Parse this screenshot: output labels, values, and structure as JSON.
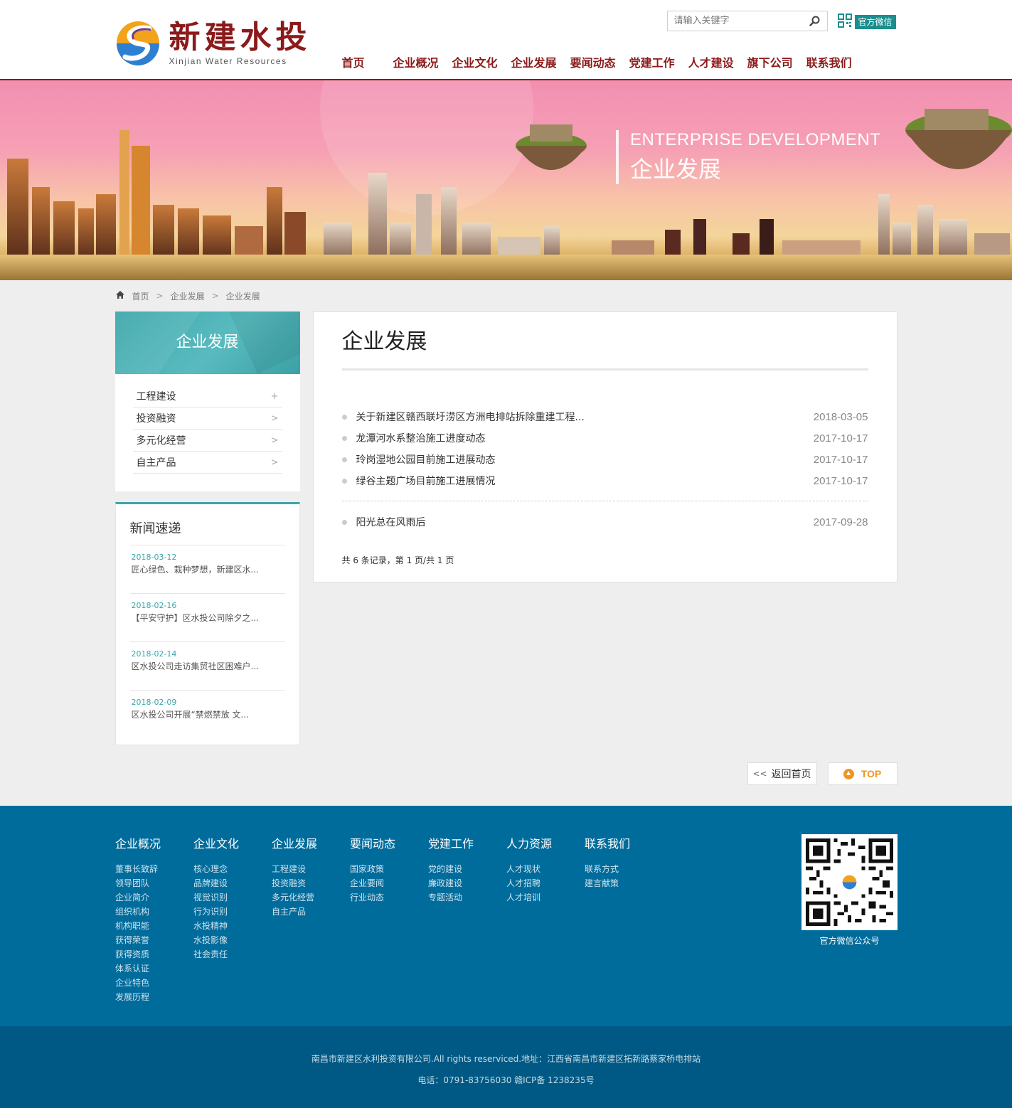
{
  "header": {
    "logo_cn": "新建水投",
    "logo_en": "Xinjian Water Resources",
    "search_placeholder": "请输入关键字",
    "wechat_label": "官方微信",
    "nav": [
      "首页",
      "企业概况",
      "企业文化",
      "企业发展",
      "要闻动态",
      "党建工作",
      "人才建设",
      "旗下公司",
      "联系我们"
    ]
  },
  "banner": {
    "en": "ENTERPRISE DEVELOPMENT",
    "cn": "企业发展"
  },
  "breadcrumb": [
    "首页",
    "企业发展",
    "企业发展"
  ],
  "breadcrumb_sep": ">",
  "sidebar": {
    "title": "企业发展",
    "items": [
      {
        "label": "工程建设",
        "icon": "+"
      },
      {
        "label": "投资融资",
        "icon": ">"
      },
      {
        "label": "多元化经营",
        "icon": ">"
      },
      {
        "label": "自主产品",
        "icon": ">"
      }
    ],
    "news_title": "新闻速递",
    "news": [
      {
        "date": "2018-03-12",
        "text": "匠心绿色、栽种梦想，新建区水..."
      },
      {
        "date": "2018-02-16",
        "text": "【平安守护】区水投公司除夕之..."
      },
      {
        "date": "2018-02-14",
        "text": "区水投公司走访集贸社区困难户..."
      },
      {
        "date": "2018-02-09",
        "text": "区水投公司开展“禁燃禁放 文..."
      }
    ]
  },
  "main": {
    "title": "企业发展",
    "articles": [
      {
        "title": "关于新建区赣西联圩涝区方洲电排站拆除重建工程...",
        "date": "2018-03-05"
      },
      {
        "title": "龙潭河水系整治施工进度动态",
        "date": "2017-10-17"
      },
      {
        "title": "玲岗湿地公园目前施工进展动态",
        "date": "2017-10-17"
      },
      {
        "title": "绿谷主题广场目前施工进展情况",
        "date": "2017-10-17"
      },
      {
        "title": "阳光总在风雨后",
        "date": "2017-09-28"
      }
    ],
    "pager": "共 6 条记录，第 1 页/共 1 页"
  },
  "buttons": {
    "home": "返回首页",
    "home_icon": "<<",
    "top": "TOP"
  },
  "footer": {
    "columns": [
      {
        "title": "企业概况",
        "links": [
          "董事长致辞",
          "领导团队",
          "企业简介",
          "组织机构",
          "机构职能",
          "获得荣誉",
          "获得资质",
          "体系认证",
          "企业特色",
          "发展历程"
        ]
      },
      {
        "title": "企业文化",
        "links": [
          "核心理念",
          "品牌建设",
          "视觉识别",
          "行为识别",
          "水投精神",
          "水投影像",
          "社会责任"
        ]
      },
      {
        "title": "企业发展",
        "links": [
          "工程建设",
          "投资融资",
          "多元化经营",
          "自主产品"
        ]
      },
      {
        "title": "要闻动态",
        "links": [
          "国家政策",
          "企业要闻",
          "行业动态"
        ]
      },
      {
        "title": "党建工作",
        "links": [
          "党的建设",
          "廉政建设",
          "专题活动"
        ]
      },
      {
        "title": "人力资源",
        "links": [
          "人才现状",
          "人才招聘",
          "人才培训"
        ]
      },
      {
        "title": "联系我们",
        "links": [
          "联系方式",
          "建言献策"
        ]
      }
    ],
    "qr_caption": "官方微信公众号",
    "copyright": "南昌市新建区水利投资有限公司.All rights reserviced.地址：江西省南昌市新建区拓新路蔡家桥电排站",
    "contact": "电话：0791-83756030 赣ICP备 1238235号"
  },
  "colors": {
    "brand_red": "#8b1a1a",
    "teal": "#3ba6aa",
    "footer_blue": "#006c9c",
    "top_orange": "#f0931f"
  }
}
